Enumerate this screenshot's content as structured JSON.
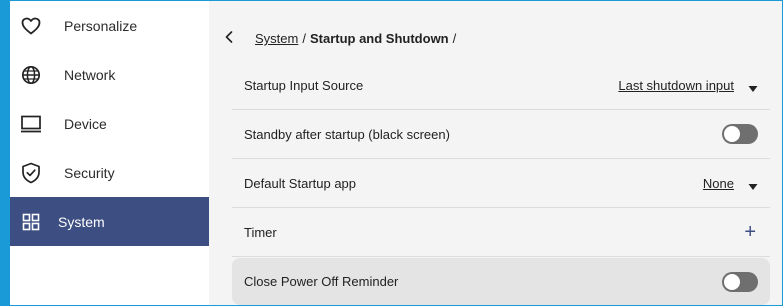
{
  "sidebar": {
    "items": [
      {
        "label": "Personalize",
        "icon": "heart-icon",
        "active": false
      },
      {
        "label": "Network",
        "icon": "globe-icon",
        "active": false
      },
      {
        "label": "Device",
        "icon": "monitor-icon",
        "active": false
      },
      {
        "label": "Security",
        "icon": "shield-check-icon",
        "active": false
      },
      {
        "label": "System",
        "icon": "grid-icon",
        "active": true
      }
    ]
  },
  "breadcrumb": {
    "back_icon": "chevron-left-icon",
    "parent": "System",
    "separator": "/",
    "current": "Startup and Shutdown",
    "trailing": "/"
  },
  "settings": {
    "startup_input": {
      "label": "Startup Input Source",
      "value": "Last shutdown input"
    },
    "standby": {
      "label": "Standby after startup (black screen)",
      "enabled": false
    },
    "default_app": {
      "label": "Default Startup app",
      "value": "None"
    },
    "timer": {
      "label": "Timer",
      "action_icon": "plus-icon",
      "action_text": "+"
    },
    "power_off_reminder": {
      "label": "Close Power Off Reminder",
      "enabled": false
    }
  },
  "colors": {
    "accent": "#1a9ad6",
    "sidebar_active": "#3c4e82",
    "toggle_off": "#6f6f6f"
  }
}
